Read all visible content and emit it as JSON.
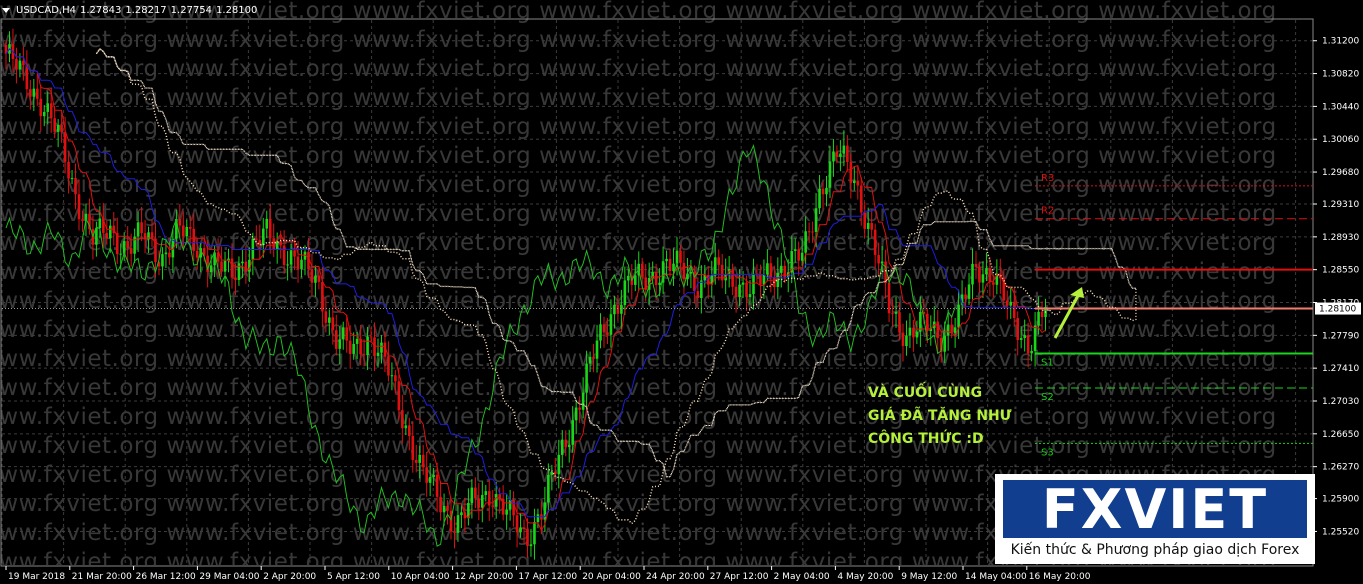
{
  "header": {
    "symbol": "USDCAD,H4",
    "open": "1.27843",
    "high": "1.28217",
    "low": "1.27754",
    "close": "1.28100"
  },
  "watermark": {
    "text": "www.fxviet.org"
  },
  "current_price_label": "1.28100",
  "annotation": {
    "line1": "VÀ CUỐI CÙNG",
    "line2": "GIÁ ĐÃ TĂNG NHƯ",
    "line3": "CÔNG THỨC :D"
  },
  "logo": {
    "word": "FXVIET",
    "tagline": "Kiến thức & Phương pháp giao dịch Forex"
  },
  "colors": {
    "background": "#000000",
    "grid": "#3c3c3c",
    "bull": "#19d619",
    "bear": "#e01010",
    "kijun": "#1e1edc",
    "tenkan": "#e01010",
    "chikou": "#22bb22",
    "cloud_bull": "#f5d9b0",
    "cloud_bear": "#ffffff",
    "resistance": "#e01010",
    "support": "#19d619",
    "arrow": "#b5f03a",
    "current_line": "#f07c70",
    "logo_blue": "#123e8f"
  },
  "chart_data": {
    "type": "candlestick",
    "symbol": "USDCAD",
    "timeframe": "H4",
    "ylim": [
      1.2512,
      1.3144
    ],
    "y_ticks": [
      "1.31200",
      "1.30820",
      "1.30440",
      "1.30060",
      "1.29680",
      "1.29310",
      "1.28930",
      "1.28550",
      "1.28170",
      "1.27790",
      "1.27410",
      "1.27030",
      "1.26650",
      "1.26270",
      "1.25900",
      "1.25520"
    ],
    "x_ticks": [
      "19 Mar 2018",
      "21 Mar 20:00",
      "26 Mar 12:00",
      "29 Mar 04:00",
      "2 Apr 20:00",
      "5 Apr 12:00",
      "10 Apr 04:00",
      "12 Apr 20:00",
      "17 Apr 12:00",
      "20 Apr 04:00",
      "24 Apr 20:00",
      "27 Apr 12:00",
      "2 May 04:00",
      "4 May 20:00",
      "9 May 12:00",
      "14 May 04:00",
      "16 May 20:00"
    ],
    "current_price": 1.281,
    "levels": [
      {
        "name": "R3",
        "value": 1.2952
      },
      {
        "name": "R2",
        "value": 1.2914
      },
      {
        "name": "S1",
        "value": 1.2758
      },
      {
        "name": "S2",
        "value": 1.2718
      },
      {
        "name": "S3",
        "value": 1.2654
      }
    ],
    "key_closes": [
      1.3105,
      1.3078,
      1.3052,
      1.301,
      1.2945,
      1.289,
      1.29,
      1.288,
      1.2895,
      1.287,
      1.29,
      1.2885,
      1.286,
      1.285,
      1.2875,
      1.2895,
      1.288,
      1.286,
      1.284,
      1.2775,
      1.276,
      1.278,
      1.274,
      1.268,
      1.262,
      1.259,
      1.256,
      1.2585,
      1.26,
      1.257,
      1.2545,
      1.258,
      1.264,
      1.27,
      1.276,
      1.281,
      1.284,
      1.2845,
      1.286,
      1.2855,
      1.284,
      1.285,
      1.2845,
      1.283,
      1.285,
      1.286,
      1.287,
      1.295,
      1.299,
      1.296,
      1.289,
      1.281,
      1.278,
      1.279,
      1.278,
      1.28,
      1.286,
      1.285,
      1.28,
      1.277,
      1.281
    ]
  }
}
